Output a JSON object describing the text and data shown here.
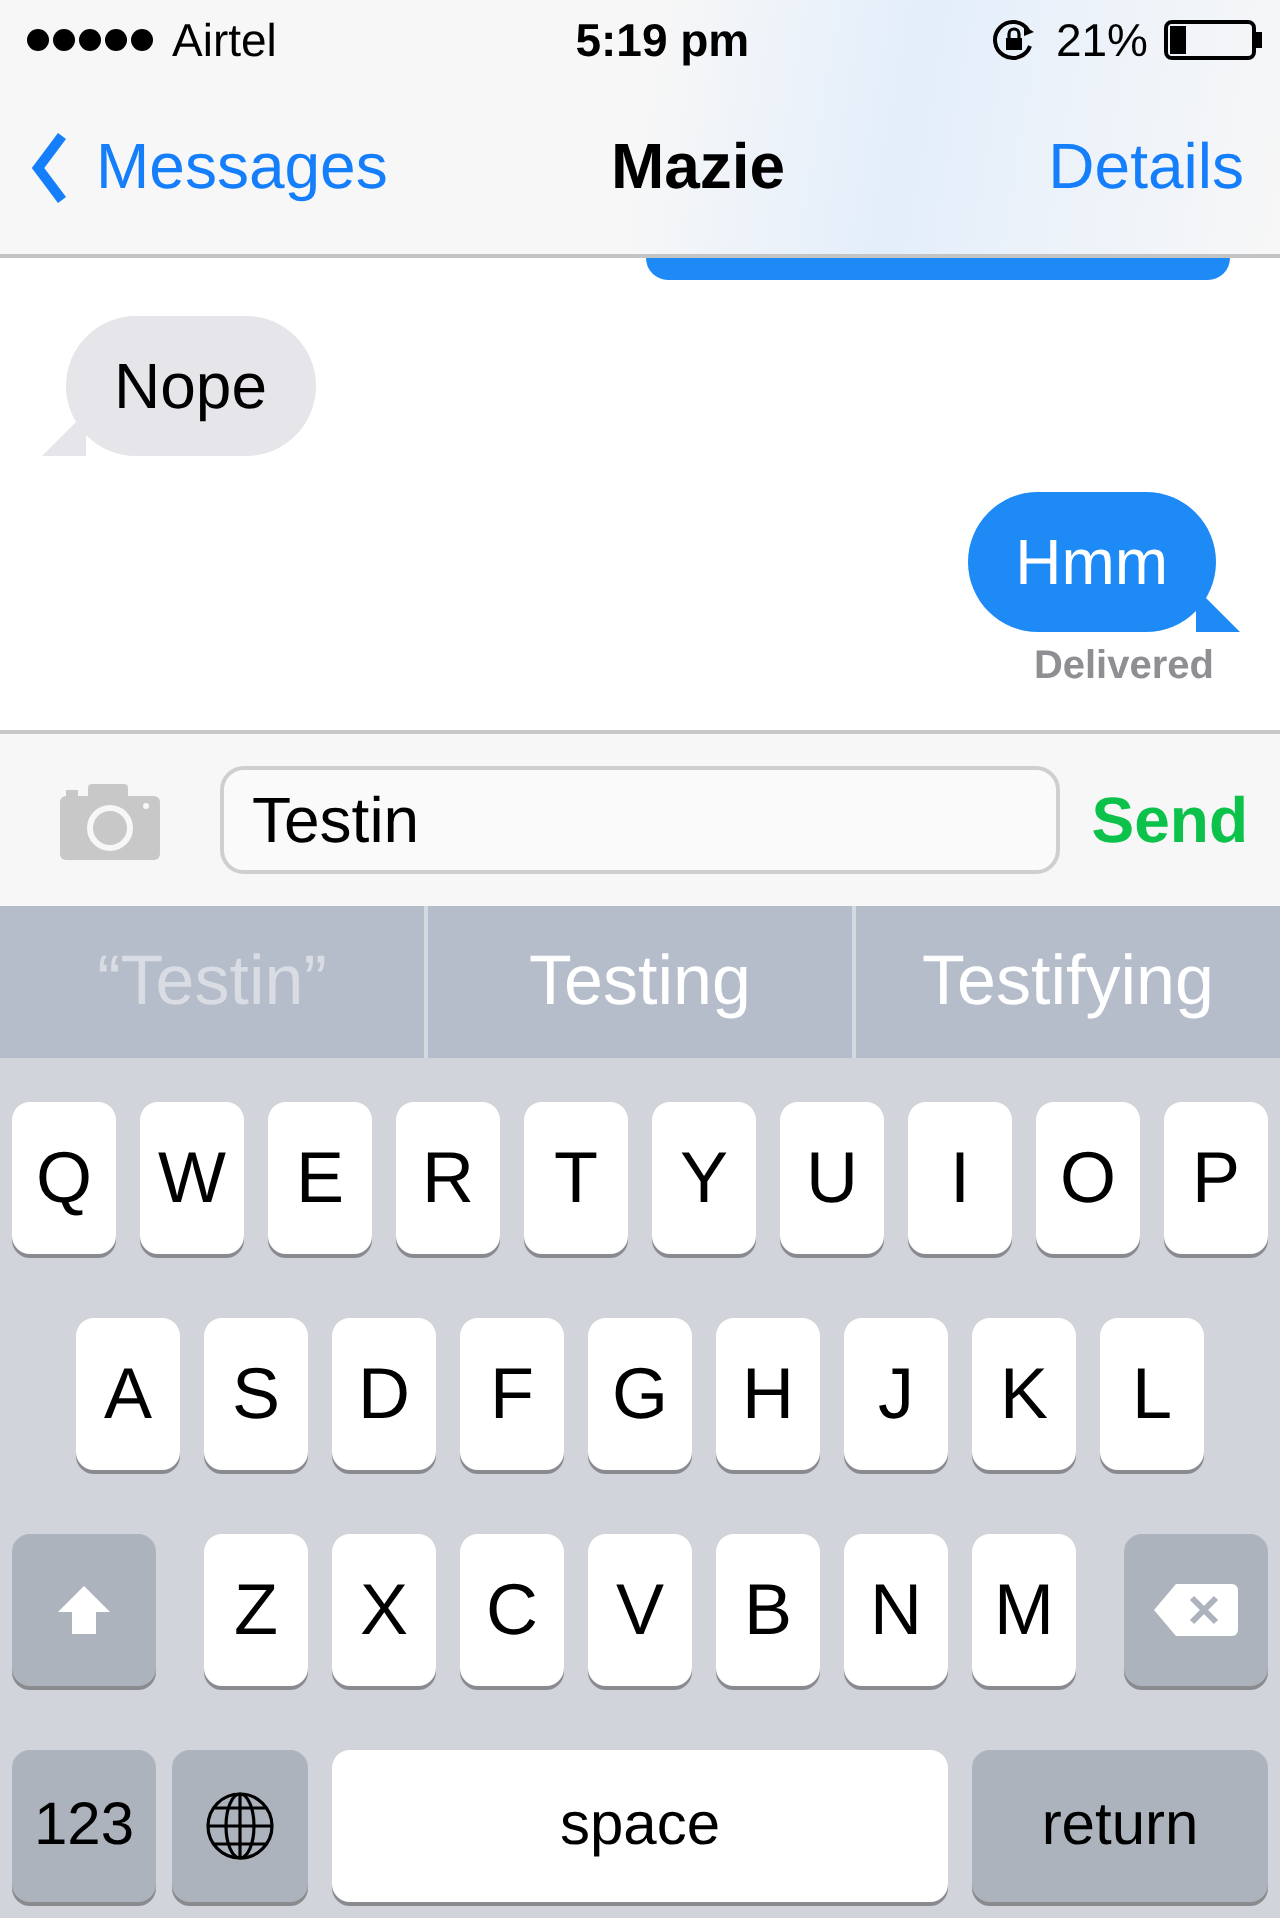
{
  "status_bar": {
    "carrier": "Airtel",
    "time": "5:19 pm",
    "battery": "21%"
  },
  "nav_bar": {
    "back": "Messages",
    "title": "Mazie",
    "action": "Details"
  },
  "messages": [
    {
      "kind": "outgoing_cut"
    },
    {
      "kind": "incoming",
      "text": "Nope"
    },
    {
      "kind": "outgoing",
      "text": "Hmm"
    }
  ],
  "delivery_status": "Delivered",
  "composer": {
    "value": "Testin",
    "send": "Send"
  },
  "suggestions": [
    {
      "kind": "literal",
      "text": "“Testin”"
    },
    {
      "kind": "word",
      "text": "Testing"
    },
    {
      "kind": "word",
      "text": "Testifying"
    }
  ],
  "keyboard": {
    "top_row": [
      {
        "kind": "letter",
        "label": "Q"
      },
      {
        "kind": "letter",
        "label": "W"
      },
      {
        "kind": "letter",
        "label": "E"
      },
      {
        "kind": "letter",
        "label": "R"
      },
      {
        "kind": "letter",
        "label": "T"
      },
      {
        "kind": "letter",
        "label": "Y"
      },
      {
        "kind": "letter",
        "label": "U"
      },
      {
        "kind": "letter",
        "label": "I"
      },
      {
        "kind": "letter",
        "label": "O"
      },
      {
        "kind": "letter",
        "label": "P"
      }
    ],
    "middle_row": [
      {
        "kind": "letter",
        "label": "A"
      },
      {
        "kind": "letter",
        "label": "S"
      },
      {
        "kind": "letter",
        "label": "D"
      },
      {
        "kind": "letter",
        "label": "F"
      },
      {
        "kind": "letter",
        "label": "G"
      },
      {
        "kind": "letter",
        "label": "H"
      },
      {
        "kind": "letter",
        "label": "J"
      },
      {
        "kind": "letter",
        "label": "K"
      },
      {
        "kind": "letter",
        "label": "L"
      }
    ],
    "bottom_row": [
      {
        "kind": "shift"
      },
      {
        "kind": "letter",
        "label": "Z"
      },
      {
        "kind": "letter",
        "label": "X"
      },
      {
        "kind": "letter",
        "label": "C"
      },
      {
        "kind": "letter",
        "label": "V"
      },
      {
        "kind": "letter",
        "label": "B"
      },
      {
        "kind": "letter",
        "label": "N"
      },
      {
        "kind": "letter",
        "label": "M"
      },
      {
        "kind": "delete"
      }
    ],
    "function_row": [
      {
        "kind": "mode",
        "label": "123"
      },
      {
        "kind": "globe"
      },
      {
        "kind": "space",
        "label": "space"
      },
      {
        "kind": "return",
        "label": "return"
      }
    ]
  }
}
